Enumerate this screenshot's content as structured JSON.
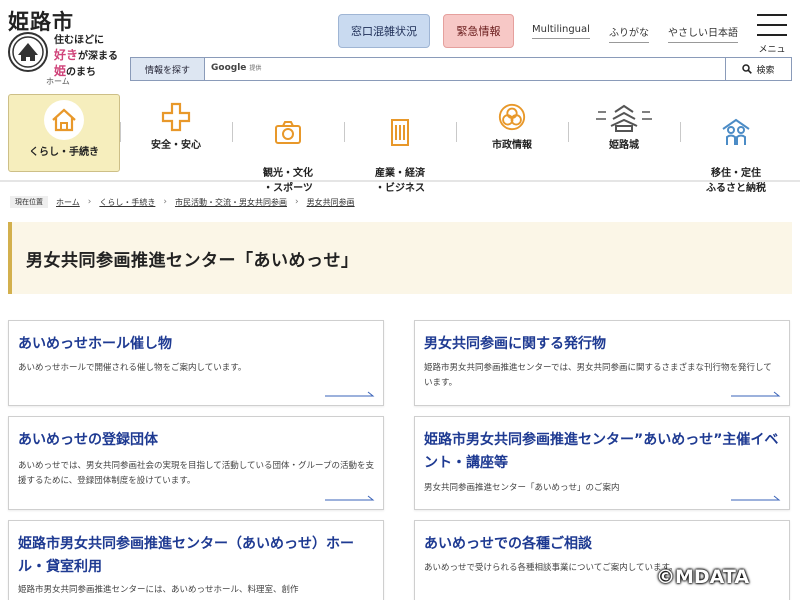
{
  "header": {
    "site_title": "姫路市",
    "tagline_lines": [
      "住むほどに",
      "好き",
      "が深まる",
      "姫",
      "のまち"
    ],
    "home_caption": "ホーム",
    "congestion_button": "窓口混雑状況",
    "emergency_button": "緊急情報",
    "links": [
      "Multilingual",
      "ふりがな",
      "やさしい日本語"
    ],
    "menu_label": "メニュー"
  },
  "search": {
    "label": "情報を探す",
    "provider": "Google",
    "provider_note": "提供",
    "button_label": "検索"
  },
  "nav": {
    "items": [
      {
        "label": "くらし・手続き",
        "icon": "house-icon",
        "active": true
      },
      {
        "label": "安全・安心",
        "icon": "plus-cross-icon",
        "active": false
      },
      {
        "label": "観光・文化\n・スポーツ",
        "icon": "camera-icon",
        "active": false
      },
      {
        "label": "産業・経済\n・ビジネス",
        "icon": "building-icon",
        "active": false
      },
      {
        "label": "市政情報",
        "icon": "city-emblem-icon",
        "active": false
      },
      {
        "label": "姫路城",
        "icon": "castle-icon",
        "active": false
      },
      {
        "label": "移住・定住\nふるさと納税",
        "icon": "family-icon",
        "active": false
      }
    ]
  },
  "breadcrumb": {
    "label": "現在位置",
    "items": [
      "ホーム",
      "くらし・手続き",
      "市民活動・交流・男女共同参画",
      "男女共同参画"
    ]
  },
  "page": {
    "title": "男女共同参画推進センター「あいめっせ」"
  },
  "cards": [
    {
      "title": "あいめっせホール催し物",
      "desc": "あいめっせホールで開催される催し物をご案内しています。"
    },
    {
      "title": "男女共同参画に関する発行物",
      "desc": "姫路市男女共同参画推進センターでは、男女共同参画に関するさまざまな刊行物を発行しています。"
    },
    {
      "title": "あいめっせの登録団体",
      "desc": "あいめっせでは、男女共同参画社会の実現を目指して活動している団体・グループの活動を支援するために、登録団体制度を設けています。"
    },
    {
      "title": "姫路市男女共同参画推進センター”あいめっせ”主催イベント・講座等",
      "desc": "男女共同参画推進センター「あいめっせ」のご案内"
    },
    {
      "title": "姫路市男女共同参画推進センター（あいめっせ）ホール・貸室利用",
      "desc": "姫路市男女共同参画推進センターには、あいめっせホール、料理室、創作"
    },
    {
      "title": "あいめっせでの各種ご相談",
      "desc": "あいめっせで受けられる各種相談事業についてご案内しています。"
    }
  ],
  "watermark": "©MDATA",
  "colors": {
    "card_title": "#1e3a92",
    "nav_active_bg": "#f6eebd",
    "title_band_bg": "#fbf6e7",
    "title_accent": "#d3b04d",
    "congestion_bg": "#c9daf0",
    "emergency_bg": "#f7c8c6",
    "icon_orange": "#e8982a"
  }
}
